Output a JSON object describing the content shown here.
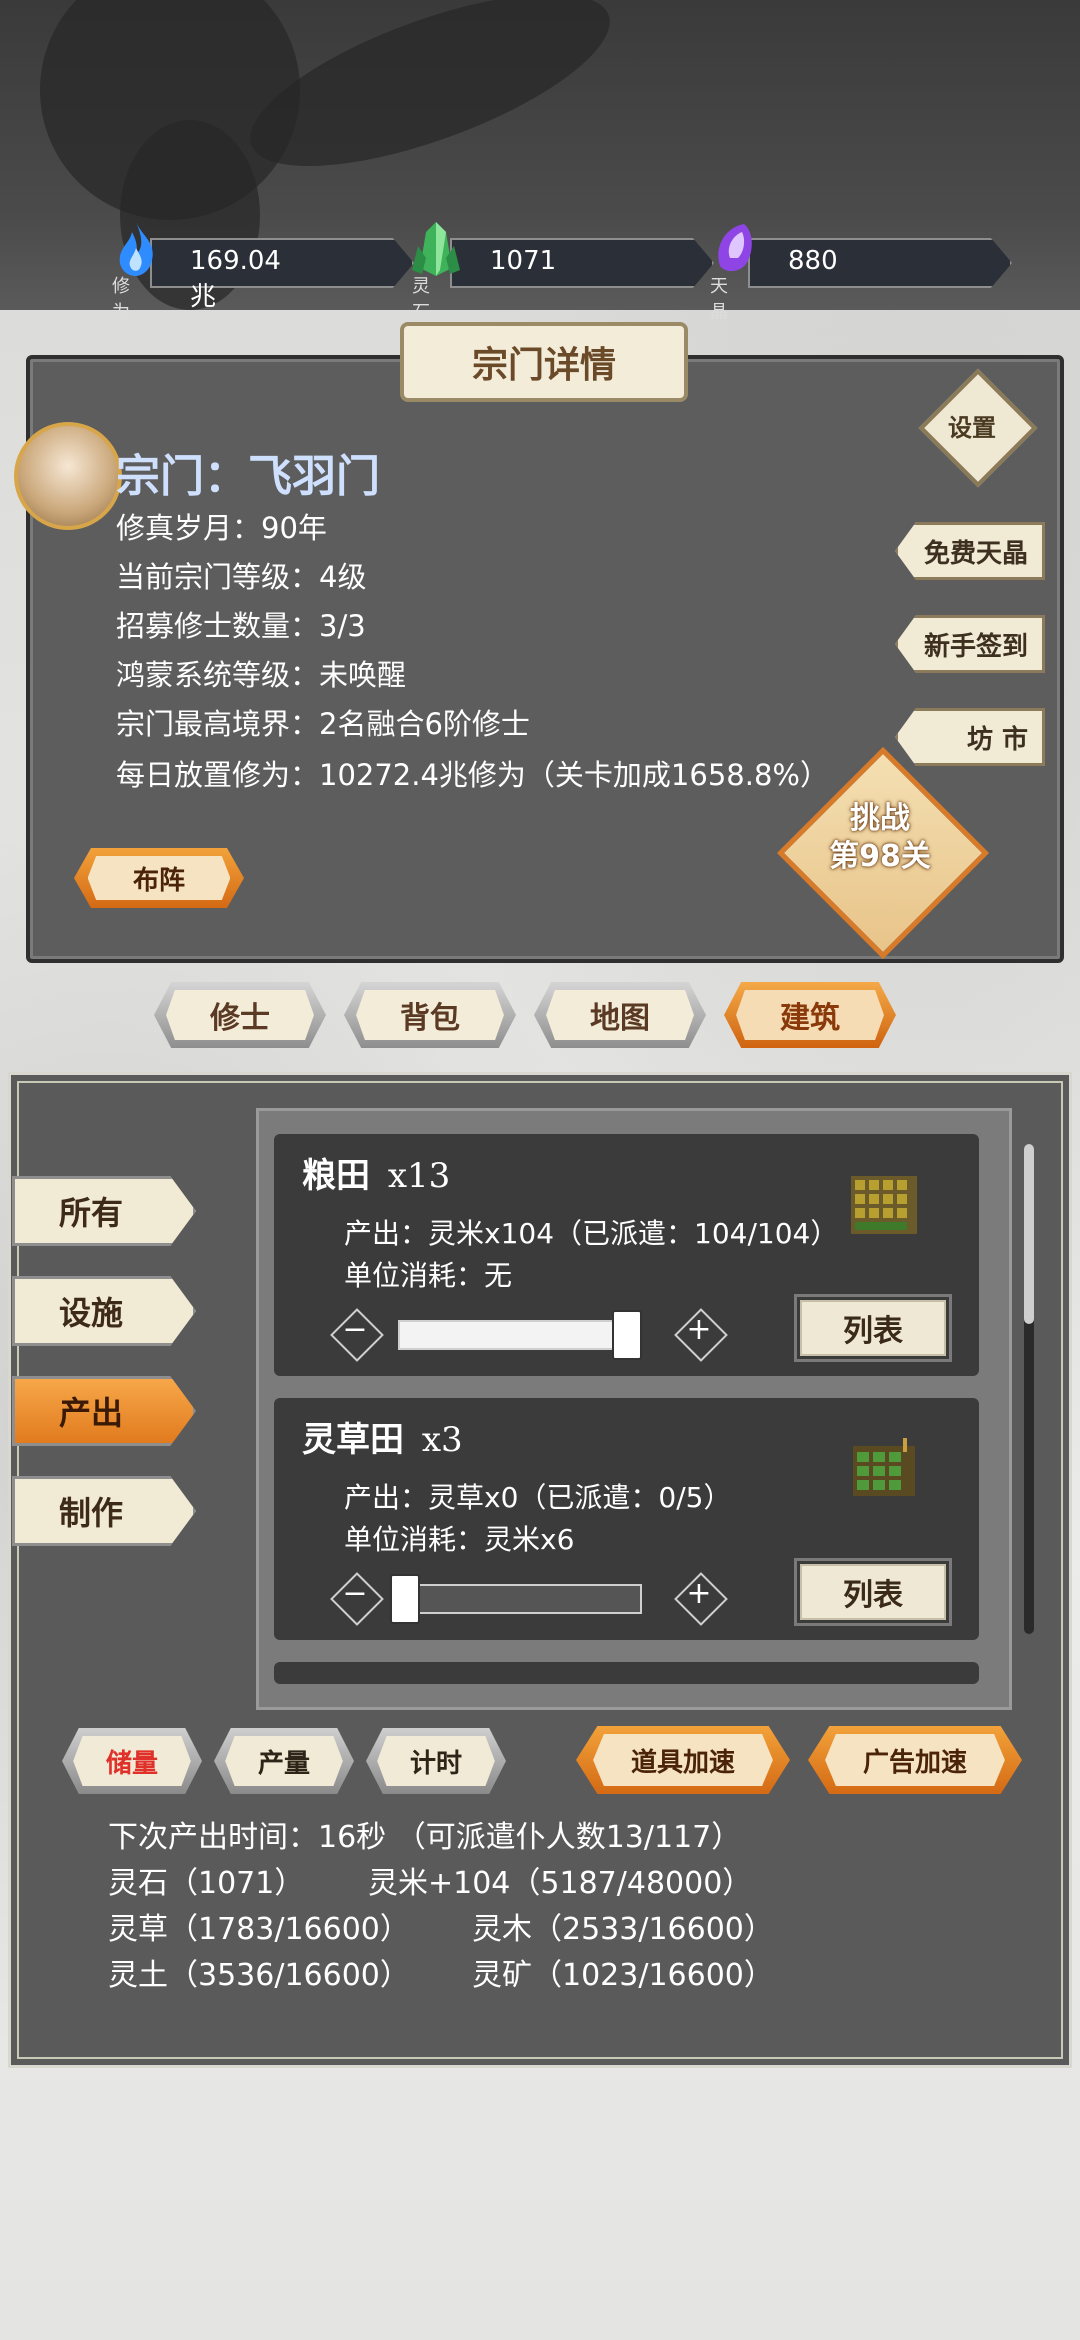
{
  "resources": [
    {
      "label": "修为",
      "value": "169.04兆",
      "icon": "blue-flame-icon",
      "color": "#3aa0ff"
    },
    {
      "label": "灵石",
      "value": "1071",
      "icon": "green-crystal-icon",
      "color": "#4fc36a"
    },
    {
      "label": "天晶",
      "value": "880",
      "icon": "purple-crystal-icon",
      "color": "#a45cf0"
    }
  ],
  "panel": {
    "title": "宗门详情",
    "sect_name": "宗门：飞羽门",
    "info": [
      "修真岁月：90年",
      "当前宗门等级：4级",
      "招募修士数量：3/3",
      "鸿蒙系统等级：未唤醒",
      "宗门最高境界：2名融合6阶修士",
      "每日放置修为：10272.4兆修为（关卡加成1658.8%）"
    ],
    "settings_label": "设置",
    "side_buttons": [
      "免费天晶",
      "新手签到",
      "坊 市"
    ],
    "challenge_line1": "挑战",
    "challenge_line2": "第98关",
    "formation_label": "布阵"
  },
  "tabs": [
    {
      "label": "修士",
      "active": false
    },
    {
      "label": "背包",
      "active": false
    },
    {
      "label": "地图",
      "active": false
    },
    {
      "label": "建筑",
      "active": true
    }
  ],
  "categories": [
    {
      "label": "所有",
      "active": false
    },
    {
      "label": "设施",
      "active": false
    },
    {
      "label": "产出",
      "active": true
    },
    {
      "label": "制作",
      "active": false
    }
  ],
  "buildings": [
    {
      "name": "粮田",
      "count": "x13",
      "output": "产出：灵米x104（已派遣：104/104）",
      "consume": "单位消耗：无",
      "assigned": 104,
      "capacity": 104,
      "list_label": "列表"
    },
    {
      "name": "灵草田",
      "count": "x3",
      "output": "产出：灵草x0（已派遣：0/5）",
      "consume": "单位消耗：灵米x6",
      "assigned": 0,
      "capacity": 5,
      "list_label": "列表"
    }
  ],
  "bottom_buttons": {
    "storage": "储量",
    "output": "产量",
    "timer": "计时",
    "item_speed": "道具加速",
    "ad_speed": "广告加速"
  },
  "stats": {
    "next_output": "下次产出时间：16秒 （可派遣仆人数13/117）",
    "stone": "灵石（1071）",
    "rice": "灵米+104（5187/48000）",
    "herb": "灵草（1783/16600）",
    "wood": "灵木（2533/16600）",
    "soil": "灵土（3536/16600）",
    "ore": "灵矿（1023/16600）"
  }
}
